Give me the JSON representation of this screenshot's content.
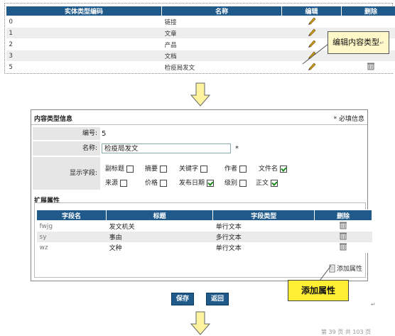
{
  "top_table": {
    "headers": [
      "实体类型编码",
      "名称",
      "编辑",
      "删除"
    ],
    "rows": [
      {
        "code": "0",
        "name": "链接"
      },
      {
        "code": "1",
        "name": "文章"
      },
      {
        "code": "2",
        "name": "产品"
      },
      {
        "code": "3",
        "name": "文档"
      },
      {
        "code": "5",
        "name": "检疫局发文"
      }
    ]
  },
  "callouts": {
    "edit_type": "编辑内容类型",
    "add_attr": "添加属性"
  },
  "form": {
    "title": "内容类型信息",
    "required_note": "* 必填信息",
    "id_label": "编号:",
    "id_value": "5",
    "name_label": "名称:",
    "name_value": "检疫局发文",
    "name_required": "*",
    "fields_label": "显示字段:",
    "fields": [
      {
        "label": "副标题",
        "checked": false
      },
      {
        "label": "摘要",
        "checked": false
      },
      {
        "label": "关键字",
        "checked": false
      },
      {
        "label": "作者",
        "checked": false
      },
      {
        "label": "文件名",
        "checked": true
      },
      {
        "label": "来源",
        "checked": false
      },
      {
        "label": "价格",
        "checked": false
      },
      {
        "label": "发布日期",
        "checked": true
      },
      {
        "label": "级别",
        "checked": false
      },
      {
        "label": "正文",
        "checked": true
      }
    ],
    "ext_title": "扩展属性",
    "ext_headers": [
      "字段名",
      "标题",
      "字段类型",
      "删除"
    ],
    "ext_rows": [
      {
        "field": "fwjg",
        "title": "发文机关",
        "type": "单行文本"
      },
      {
        "field": "sy",
        "title": "事由",
        "type": "多行文本"
      },
      {
        "field": "wz",
        "title": "文种",
        "type": "单行文本"
      }
    ],
    "add_attr_label": "添加属性"
  },
  "buttons": {
    "save": "保存",
    "back": "返回"
  },
  "footer": "第 39 页 共 103 页"
}
